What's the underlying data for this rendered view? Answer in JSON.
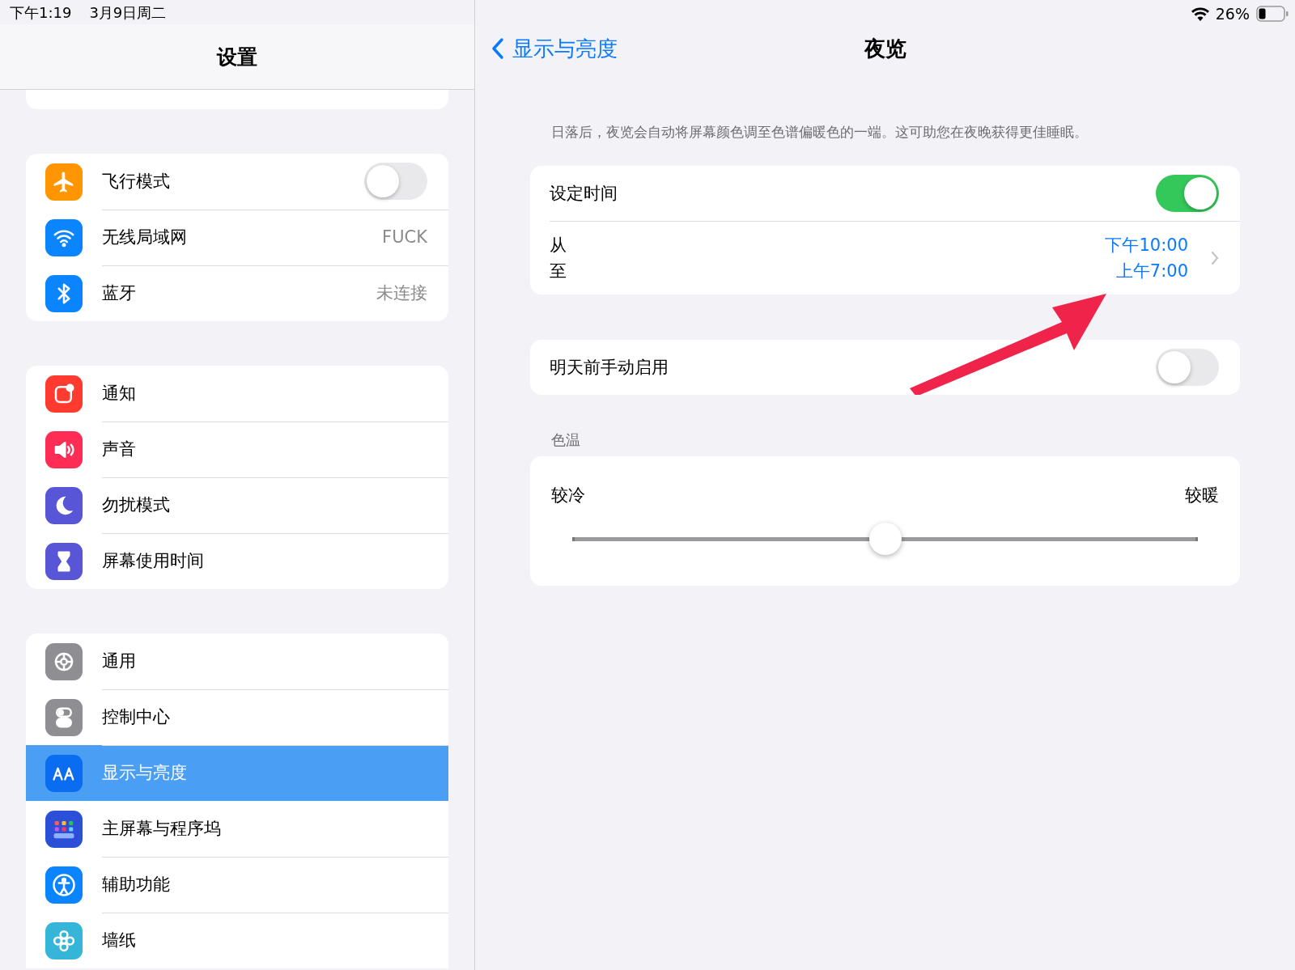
{
  "status_bar": {
    "time": "下午1:19",
    "date": "3月9日周二",
    "battery": "26%"
  },
  "sidebar": {
    "title": "设置",
    "groups": [
      {
        "items": [
          {
            "label": "飞行模式",
            "kind": "toggle",
            "on": false,
            "selected": false,
            "color": "#ff9500"
          },
          {
            "label": "无线局域网",
            "kind": "value",
            "value": "FUCK",
            "selected": false,
            "color": "#0a84ff"
          },
          {
            "label": "蓝牙",
            "kind": "value",
            "value": "未连接",
            "selected": false,
            "color": "#0a84ff"
          }
        ]
      },
      {
        "items": [
          {
            "label": "通知",
            "kind": "link",
            "selected": false,
            "color": "#ff3b30"
          },
          {
            "label": "声音",
            "kind": "link",
            "selected": false,
            "color": "#ff2d55"
          },
          {
            "label": "勿扰模式",
            "kind": "link",
            "selected": false,
            "color": "#5856d6"
          },
          {
            "label": "屏幕使用时间",
            "kind": "link",
            "selected": false,
            "color": "#5856d6"
          }
        ]
      },
      {
        "items": [
          {
            "label": "通用",
            "kind": "link",
            "selected": false,
            "color": "#8e8e93"
          },
          {
            "label": "控制中心",
            "kind": "link",
            "selected": false,
            "color": "#8e8e93"
          },
          {
            "label": "显示与亮度",
            "kind": "link",
            "selected": true,
            "color": "#0a6cf0"
          },
          {
            "label": "主屏幕与程序坞",
            "kind": "link",
            "selected": false,
            "color": "#2c4fd8"
          },
          {
            "label": "辅助功能",
            "kind": "link",
            "selected": false,
            "color": "#0a84ff"
          },
          {
            "label": "墙纸",
            "kind": "link",
            "selected": false,
            "color": "#35b6d8"
          }
        ]
      }
    ]
  },
  "detail": {
    "back": "显示与亮度",
    "title": "夜览",
    "description": "日落后，夜览会自动将屏幕颜色调至色谱偏暖色的一端。这可助您在夜晚获得更佳睡眠。",
    "schedule": {
      "label": "设定时间",
      "on": true,
      "from_label": "从",
      "to_label": "至",
      "from": "下午10:00",
      "to": "上午7:00"
    },
    "manual": {
      "label": "明天前手动启用",
      "on": false
    },
    "temperature": {
      "header": "色温",
      "min_label": "较冷",
      "max_label": "较暖",
      "level": 0.5
    }
  }
}
